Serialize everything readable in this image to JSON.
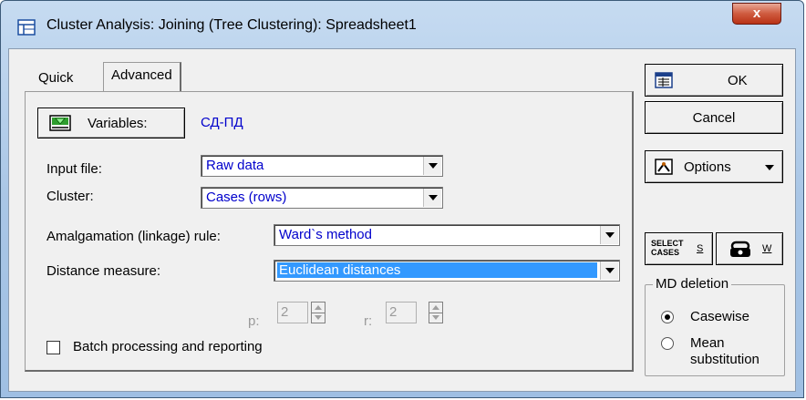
{
  "window": {
    "title": "Cluster Analysis: Joining (Tree Clustering): Spreadsheet1",
    "close_label": "x"
  },
  "tabs": [
    {
      "label": "Quick",
      "active": false
    },
    {
      "label": "Advanced",
      "active": true
    }
  ],
  "variables": {
    "button_label": "Variables:",
    "value": "СД-ПД"
  },
  "fields": {
    "input_file": {
      "label": "Input file:",
      "value": "Raw data"
    },
    "cluster": {
      "label": "Cluster:",
      "value": "Cases (rows)"
    },
    "amalgamation": {
      "label": "Amalgamation (linkage) rule:",
      "value": "Ward`s method"
    },
    "distance": {
      "label": "Distance measure:",
      "value": "Euclidean distances"
    }
  },
  "params": {
    "p_label": "p:",
    "p_value": "2",
    "r_label": "r:",
    "r_value": "2"
  },
  "batch": {
    "label": "Batch processing and reporting",
    "checked": false
  },
  "buttons": {
    "ok": "OK",
    "cancel": "Cancel",
    "options": "Options",
    "select_cases_top": "SELECT",
    "select_cases_bottom": "CASES",
    "select_cases_key": "S",
    "weight_key": "W"
  },
  "md_deletion": {
    "legend": "MD deletion",
    "options": [
      {
        "label": "Casewise",
        "checked": true
      },
      {
        "label": "Mean substitution",
        "line1": "Mean",
        "line2": "substitution",
        "checked": false
      }
    ]
  },
  "colors": {
    "value_text": "#0000cc",
    "selection": "#3399ff",
    "close_button": "#c8462a"
  }
}
